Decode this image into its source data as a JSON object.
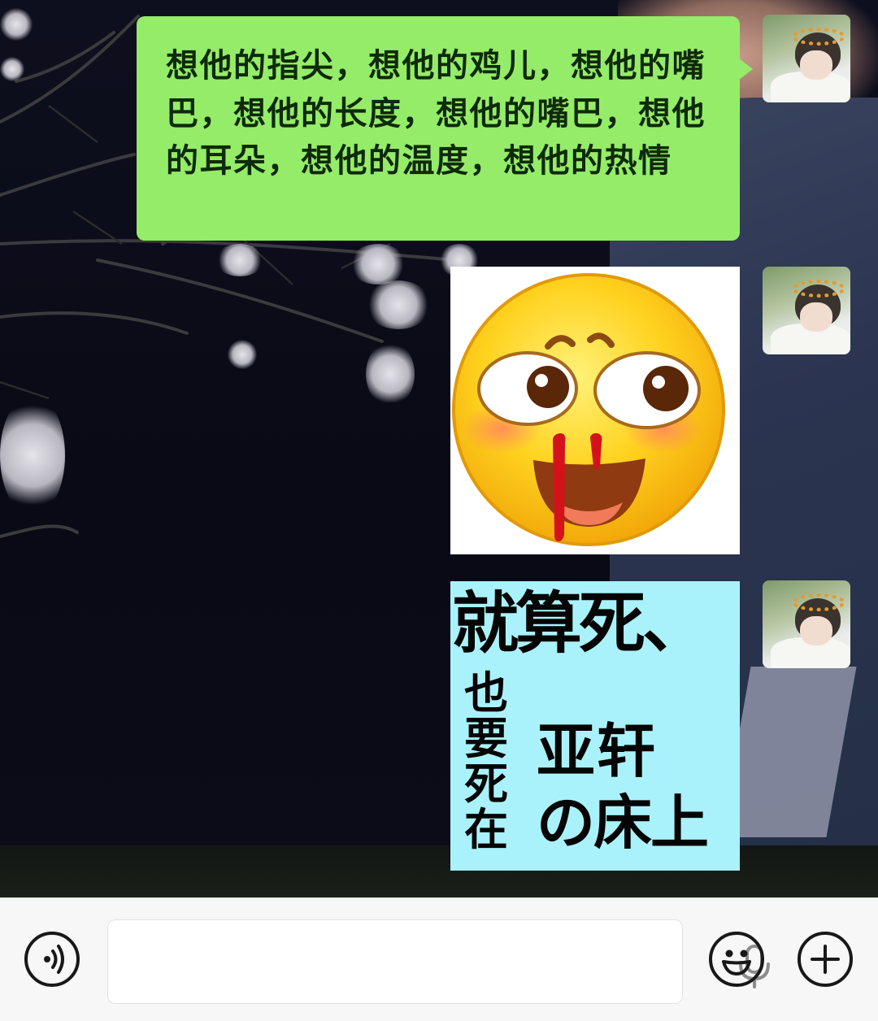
{
  "chat": {
    "messages": [
      {
        "type": "text",
        "sender": "self",
        "text": "想他的指尖，想他的鸡儿，想他的嘴巴，想他的长度，想他的嘴巴，想他的耳朵，想他的温度，想他的热情",
        "bubble_color": "#95ec69"
      },
      {
        "type": "sticker",
        "sender": "self",
        "sticker": "blushing-nosebleed-smiley-sticker"
      },
      {
        "type": "image-text-card",
        "sender": "self",
        "line1": "就算死、",
        "vertical": "也要死在",
        "name": "亚轩",
        "place": "の床上",
        "background_color": "#aaf2fb"
      }
    ],
    "avatar": "self-avatar-flower-crown"
  },
  "input_bar": {
    "voice_icon": "voice-mode-icon",
    "text_value": "",
    "mic_icon": "microphone-icon",
    "emoji_icon": "emoji-icon",
    "plus_icon": "plus-icon",
    "background": "#f7f7f7"
  }
}
